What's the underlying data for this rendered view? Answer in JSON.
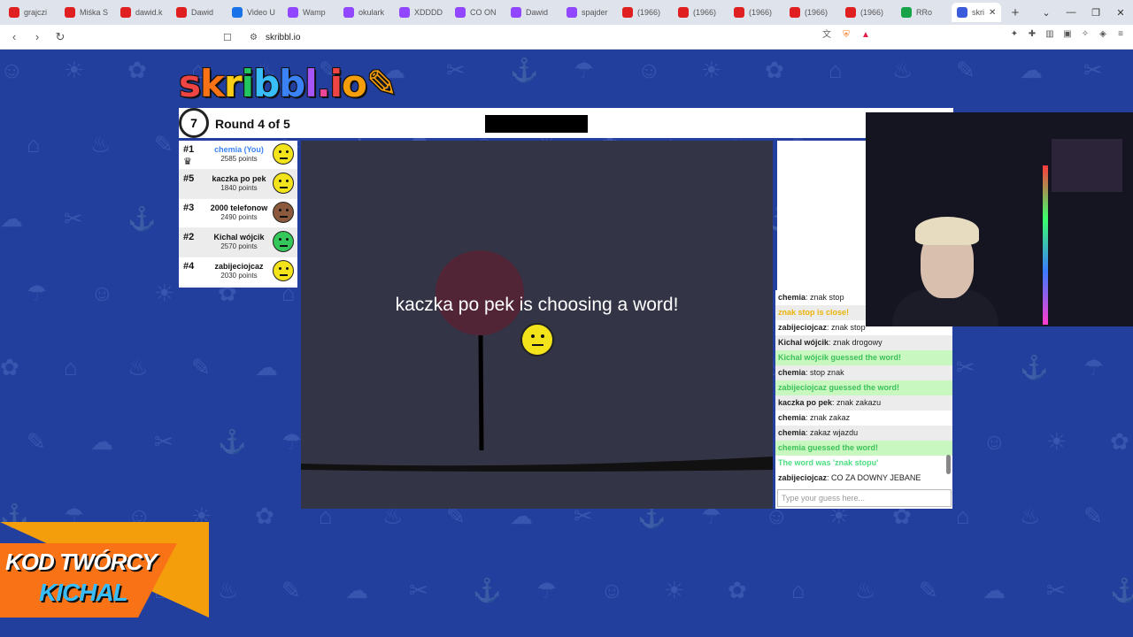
{
  "browser": {
    "tabs": [
      {
        "label": "grajczi",
        "color": "#e02020"
      },
      {
        "label": "Miśka S",
        "color": "#e02020"
      },
      {
        "label": "dawid.k",
        "color": "#e02020"
      },
      {
        "label": "Dawid",
        "color": "#e02020"
      },
      {
        "label": "Video U",
        "color": "#1a73e8"
      },
      {
        "label": "Wamp",
        "color": "#9146ff"
      },
      {
        "label": "okulark",
        "color": "#9146ff"
      },
      {
        "label": "XDDDD",
        "color": "#9146ff"
      },
      {
        "label": "CO ON",
        "color": "#9146ff"
      },
      {
        "label": "Dawid",
        "color": "#9146ff"
      },
      {
        "label": "spajder",
        "color": "#9146ff"
      },
      {
        "label": "(1966)",
        "color": "#e02020"
      },
      {
        "label": "(1966)",
        "color": "#e02020"
      },
      {
        "label": "(1966)",
        "color": "#e02020"
      },
      {
        "label": "(1966)",
        "color": "#e02020"
      },
      {
        "label": "(1966)",
        "color": "#e02020"
      },
      {
        "label": "RRo",
        "color": "#16a34a"
      },
      {
        "label": "skri",
        "color": "#3b5bdb",
        "active": true
      }
    ],
    "url": "skribbl.io"
  },
  "logo": {
    "letters": [
      {
        "ch": "s",
        "color": "#ef4444"
      },
      {
        "ch": "k",
        "color": "#f97316"
      },
      {
        "ch": "r",
        "color": "#facc15"
      },
      {
        "ch": "i",
        "color": "#22c55e"
      },
      {
        "ch": "b",
        "color": "#38bdf8"
      },
      {
        "ch": "b",
        "color": "#3b82f6"
      },
      {
        "ch": "l",
        "color": "#a855f7"
      },
      {
        "ch": ".",
        "color": "#ec4899"
      },
      {
        "ch": "i",
        "color": "#ef4444"
      },
      {
        "ch": "o",
        "color": "#f59e0b"
      }
    ]
  },
  "game": {
    "timer": "7",
    "round_label": "Round 4 of 5",
    "canvas_message": "kaczka po pek is choosing a word!"
  },
  "players": [
    {
      "rank": "#1",
      "name": "chemia (You)",
      "points": "2585 points",
      "you": true,
      "crown": true,
      "color": "#f2e31a"
    },
    {
      "rank": "#5",
      "name": "kaczka po pek",
      "points": "1840 points",
      "color": "#f2e31a"
    },
    {
      "rank": "#3",
      "name": "2000 telefonow",
      "points": "2490 points",
      "color": "#8b5a3c"
    },
    {
      "rank": "#2",
      "name": "Kichal wójcik",
      "points": "2570 points",
      "color": "#34c759"
    },
    {
      "rank": "#4",
      "name": "zabijeciojcaz",
      "points": "2030 points",
      "color": "#f2e31a"
    }
  ],
  "chat": {
    "messages": [
      {
        "who": "chemia",
        "text": "znak stop"
      },
      {
        "who": "",
        "text": "znak stop is close!",
        "style": "yellow"
      },
      {
        "who": "zabijeciojcaz",
        "text": "znak stop"
      },
      {
        "who": "Kichal wójcik",
        "text": "znak drogowy"
      },
      {
        "who": "",
        "text": "Kichal wójcik guessed the word!",
        "style": "green bg"
      },
      {
        "who": "chemia",
        "text": "stop znak"
      },
      {
        "who": "",
        "text": "zabijeciojcaz guessed the word!",
        "style": "green bg"
      },
      {
        "who": "kaczka po pek",
        "text": "znak zakazu"
      },
      {
        "who": "chemia",
        "text": "znak zakaz"
      },
      {
        "who": "chemia",
        "text": "zakaz wjazdu"
      },
      {
        "who": "",
        "text": "chemia guessed the word!",
        "style": "green bg"
      },
      {
        "who": "",
        "text": "The word was 'znak stopu'",
        "style": "green"
      },
      {
        "who": "zabijeciojcaz",
        "text": "CO ZA DOWNY JEBANE"
      }
    ],
    "input_placeholder": "Type your guess here..."
  },
  "promo": {
    "line1": "KOD TWÓRCY",
    "line2": "KICHAL"
  }
}
